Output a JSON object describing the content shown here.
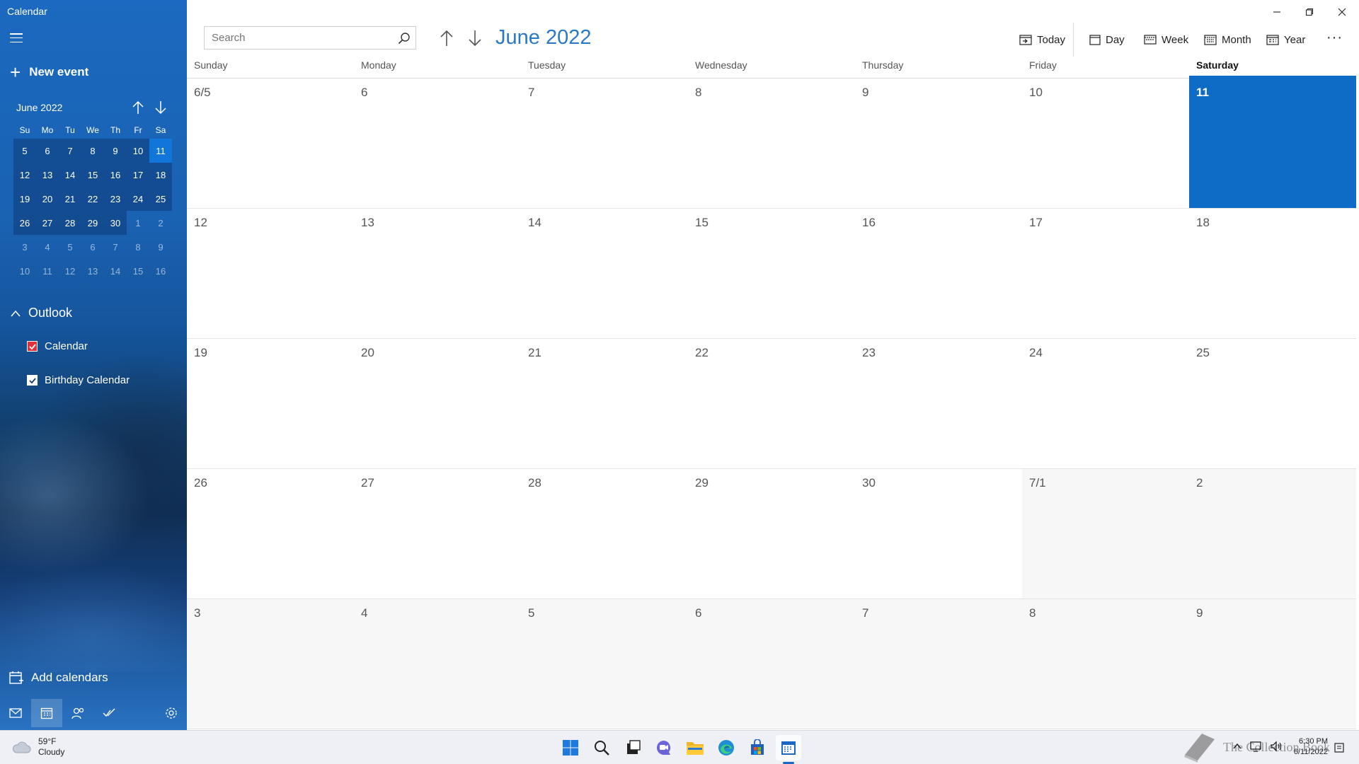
{
  "window": {
    "title": "Calendar"
  },
  "sidebar": {
    "new_event_label": "New event",
    "mini_calendar": {
      "label": "June 2022",
      "weekday_headers": [
        "Su",
        "Mo",
        "Tu",
        "We",
        "Th",
        "Fr",
        "Sa"
      ],
      "weeks": [
        [
          "5",
          "6",
          "7",
          "8",
          "9",
          "10",
          "11"
        ],
        [
          "12",
          "13",
          "14",
          "15",
          "16",
          "17",
          "18"
        ],
        [
          "19",
          "20",
          "21",
          "22",
          "23",
          "24",
          "25"
        ],
        [
          "26",
          "27",
          "28",
          "29",
          "30",
          "1",
          "2"
        ],
        [
          "3",
          "4",
          "5",
          "6",
          "7",
          "8",
          "9"
        ],
        [
          "10",
          "11",
          "12",
          "13",
          "14",
          "15",
          "16"
        ]
      ],
      "selected_day": "11"
    },
    "account_label": "Outlook",
    "calendars": [
      {
        "label": "Calendar",
        "checked": true,
        "color": "#e0303c"
      },
      {
        "label": "Birthday Calendar",
        "checked": true,
        "color": "#ffffff"
      }
    ],
    "add_calendars_label": "Add calendars",
    "bottom_nav": [
      "mail-icon",
      "calendar-icon",
      "people-icon",
      "todo-icon",
      "settings-icon"
    ]
  },
  "toolbar": {
    "search_placeholder": "Search",
    "month_title": "June 2022",
    "views": {
      "today": "Today",
      "day": "Day",
      "week": "Week",
      "month": "Month",
      "year": "Year"
    },
    "more_label": "···"
  },
  "month_view": {
    "weekday_headers": [
      "Sunday",
      "Monday",
      "Tuesday",
      "Wednesday",
      "Thursday",
      "Friday",
      "Saturday"
    ],
    "weeks": [
      [
        "6/5",
        "6",
        "7",
        "8",
        "9",
        "10",
        "11"
      ],
      [
        "12",
        "13",
        "14",
        "15",
        "16",
        "17",
        "18"
      ],
      [
        "19",
        "20",
        "21",
        "22",
        "23",
        "24",
        "25"
      ],
      [
        "26",
        "27",
        "28",
        "29",
        "30",
        "7/1",
        "2"
      ],
      [
        "3",
        "4",
        "5",
        "6",
        "7",
        "8",
        "9"
      ]
    ],
    "today": "11",
    "accent_color": "#0f6cc6"
  },
  "taskbar": {
    "weather_temp": "59°F",
    "weather_desc": "Cloudy",
    "pinned": [
      "windows-start-icon",
      "search-icon",
      "task-view-icon",
      "chat-icon",
      "file-explorer-icon",
      "edge-icon",
      "store-icon",
      "calendar-app-icon"
    ],
    "time": "6:30 PM",
    "date": "6/11/2022",
    "watermark": "The Collection Book"
  }
}
